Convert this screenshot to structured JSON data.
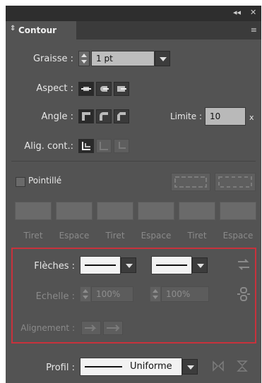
{
  "panel": {
    "title": "Contour",
    "window_controls": {
      "collapse": "◂◂",
      "close": "✕"
    },
    "menu_icon": "≡"
  },
  "stroke": {
    "weight_label": "Graisse :",
    "weight_value": "1 pt",
    "cap_label": "Aspect :",
    "corner_label": "Angle :",
    "limit_label": "Limite :",
    "limit_value": "10",
    "limit_unit": "x",
    "align_label": "Alig. cont.:"
  },
  "dashed": {
    "label": "Pointillé",
    "fields": [
      {
        "label": "Tiret"
      },
      {
        "label": "Espace"
      },
      {
        "label": "Tiret"
      },
      {
        "label": "Espace"
      },
      {
        "label": "Tiret"
      },
      {
        "label": "Espace"
      }
    ]
  },
  "arrowheads": {
    "label": "Flèches :",
    "scale_label": "Echelle :",
    "scale_start": "100%",
    "scale_end": "100%",
    "align_label": "Alignement :"
  },
  "profile": {
    "label": "Profil :",
    "value": "Uniforme"
  }
}
